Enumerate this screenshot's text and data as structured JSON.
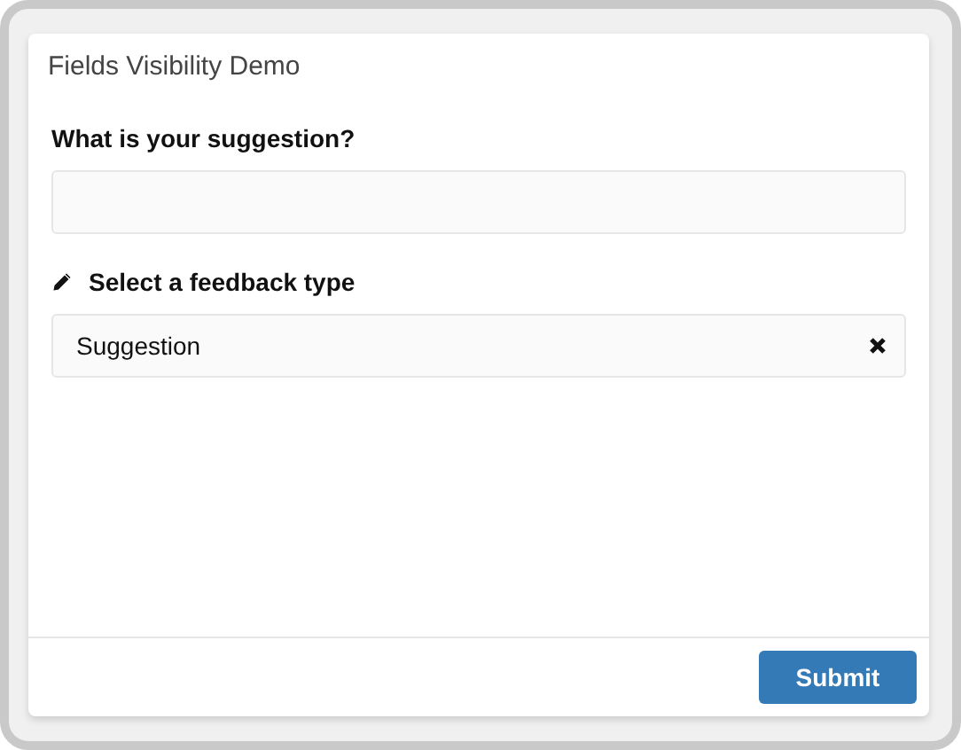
{
  "window": {
    "title": "Fields Visibility Demo"
  },
  "fields": [
    {
      "kind": "text",
      "label": "What is your suggestion?"
    },
    {
      "kind": "select",
      "label": "Select a feedback type",
      "value": "Suggestion"
    }
  ],
  "buttons": [
    "Submit"
  ]
}
